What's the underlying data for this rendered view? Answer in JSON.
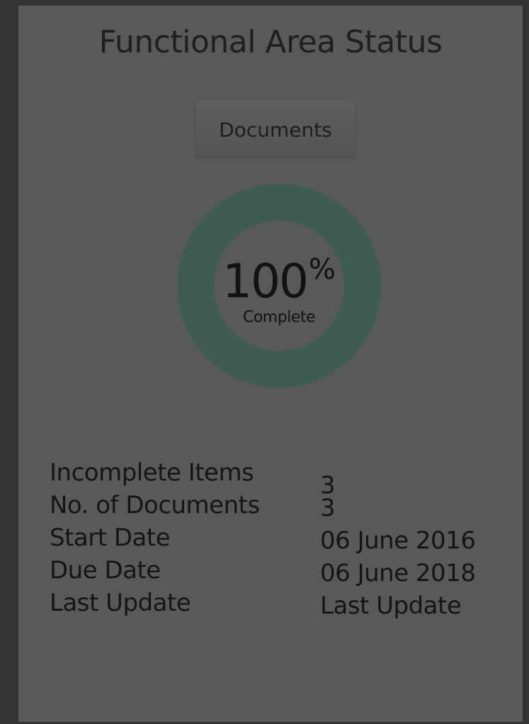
{
  "panel": {
    "title": "Functional Area Status"
  },
  "tab": {
    "label": "Documents"
  },
  "progress": {
    "value": 100,
    "number_text": "100",
    "symbol": "%",
    "caption": "Complete",
    "ring_color": "#3e5c4f",
    "track_color": "#58595b"
  },
  "details": [
    {
      "label": "Incomplete Items",
      "value": "3"
    },
    {
      "label": "No. of Documents",
      "value": "3"
    },
    {
      "label": "Start Date",
      "value": "06 June 2016"
    },
    {
      "label": "Due Date",
      "value": "06 June 2018"
    },
    {
      "label": "Last Update",
      "value": "Last Update"
    }
  ]
}
